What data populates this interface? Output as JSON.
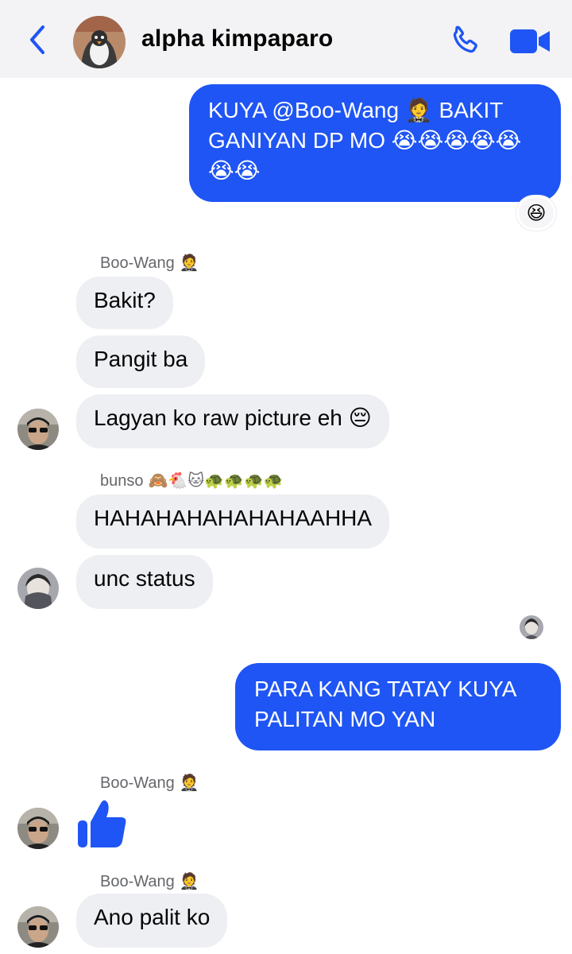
{
  "header": {
    "back_icon": "chevron-left-icon",
    "contact_name": "alpha kimpaparo",
    "call_icon": "phone-icon",
    "video_icon": "video-camera-icon",
    "accent_color": "#1f55f4"
  },
  "messages": [
    {
      "direction": "outgoing",
      "text": "KUYA @Boo-Wang 🤵 BAKIT GANIYAN DP MO 😭😭😭😭😭😭😭",
      "reaction": "😆"
    },
    {
      "direction": "incoming",
      "sender": "Boo-Wang",
      "sender_emoji": "🤵",
      "text": "Bakit?"
    },
    {
      "direction": "incoming",
      "text": "Pangit ba"
    },
    {
      "direction": "incoming",
      "text": "Lagyan ko raw picture eh 😔"
    },
    {
      "direction": "incoming",
      "sender": "bunso",
      "sender_emoji": "🙈🐔🐱🐢🐢🐢🐢",
      "text": "HAHAHAHAHAHAHAAHHA"
    },
    {
      "direction": "incoming",
      "text": "unc status"
    },
    {
      "direction": "outgoing",
      "text": "PARA KANG TATAY KUYA PALITAN MO YAN"
    },
    {
      "direction": "incoming",
      "sender": "Boo-Wang",
      "sender_emoji": "🤵",
      "icon": "thumbs-up-icon"
    },
    {
      "direction": "incoming",
      "sender": "Boo-Wang",
      "sender_emoji": "🤵",
      "text": "Ano palit ko"
    }
  ],
  "ui": {
    "outgoing_bubble_color": "#1f55f4",
    "incoming_bubble_color": "#eeeff3"
  }
}
